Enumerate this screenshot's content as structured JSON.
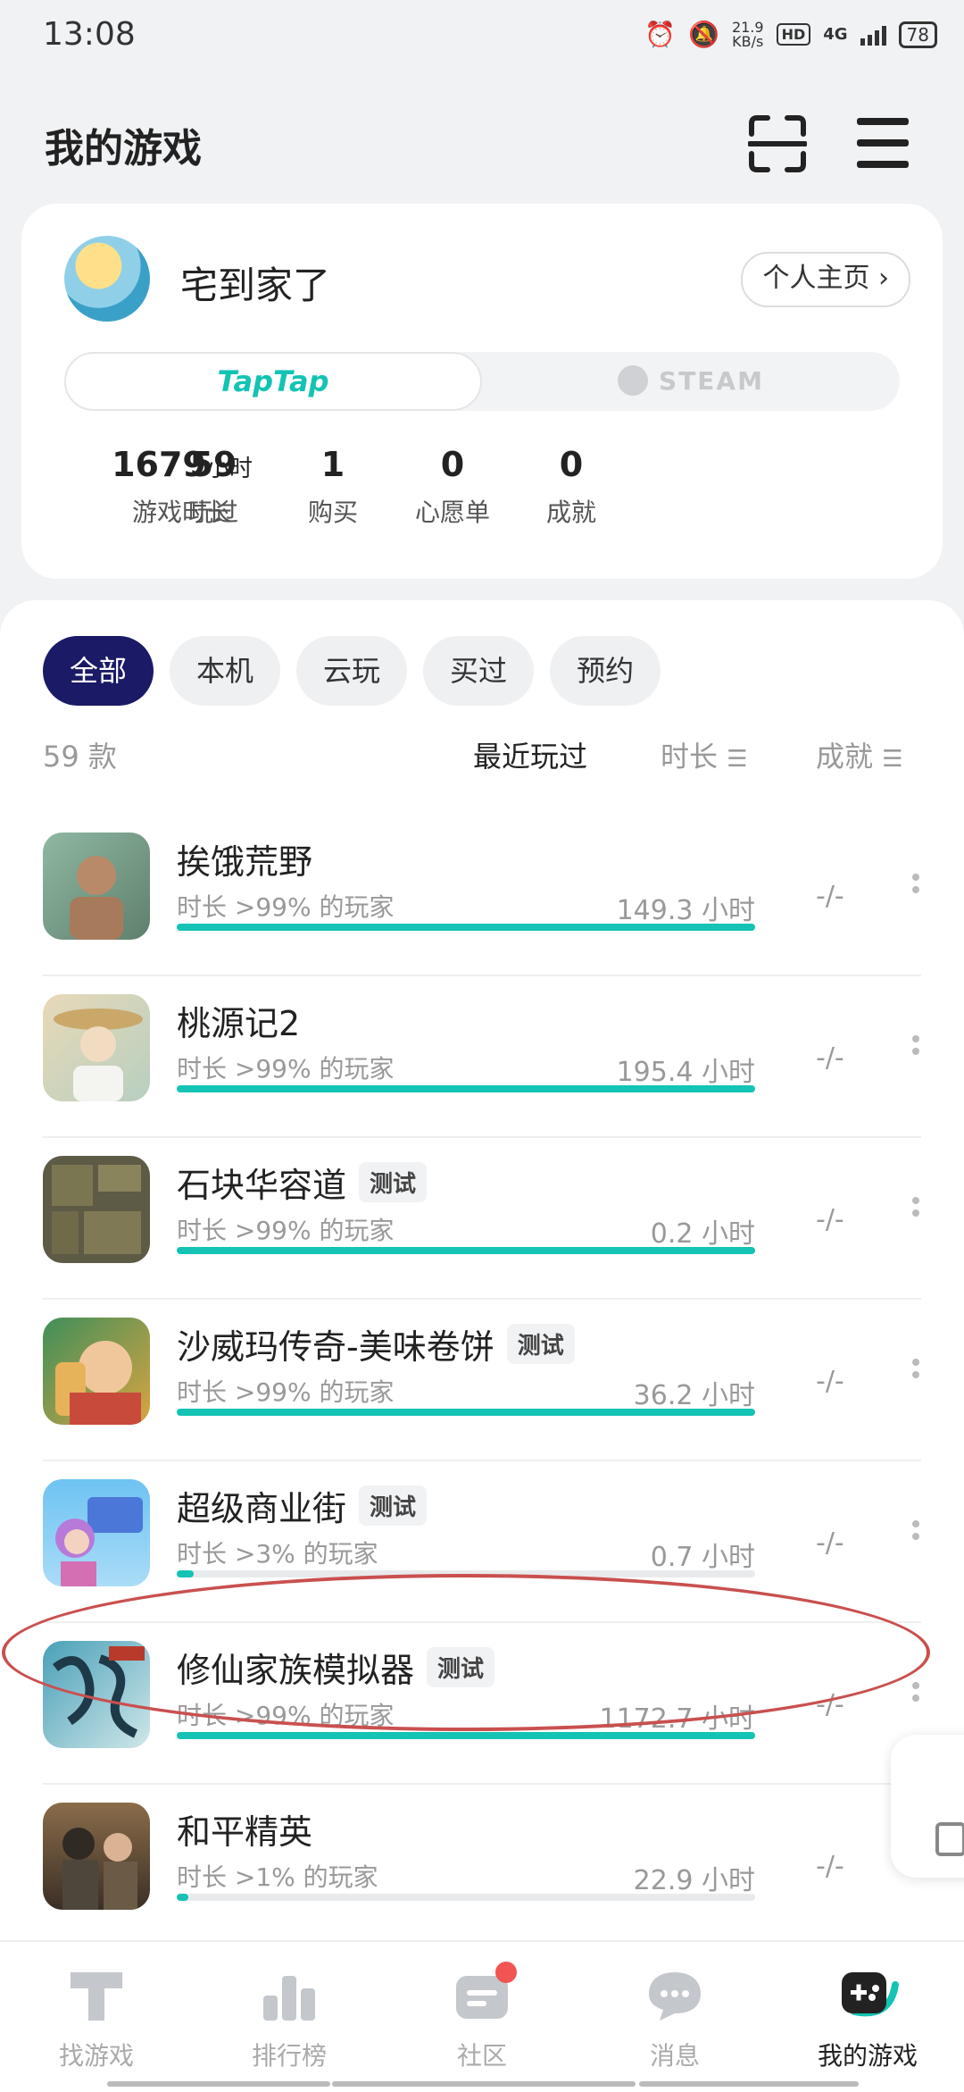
{
  "status_bar": {
    "time": "13:08",
    "speed_value": "21.9",
    "speed_unit": "KB/s",
    "hd": "HD",
    "network": "4G",
    "battery": "78"
  },
  "header": {
    "title": "我的游戏"
  },
  "profile": {
    "username": "宅到家了",
    "home_button": "个人主页 ›",
    "platform_tabs": {
      "taptap": "TapTap",
      "steam": "STEAM"
    },
    "stats": [
      {
        "value": "1679",
        "unit": "小时",
        "label": "游戏时长"
      },
      {
        "value": "59",
        "unit": "",
        "label": "玩过"
      },
      {
        "value": "1",
        "unit": "",
        "label": "购买"
      },
      {
        "value": "0",
        "unit": "",
        "label": "心愿单"
      },
      {
        "value": "0",
        "unit": "",
        "label": "成就"
      }
    ]
  },
  "filters": [
    "全部",
    "本机",
    "云玩",
    "买过",
    "预约"
  ],
  "sort": {
    "count": "59 款",
    "recent": "最近玩过",
    "duration": "时长",
    "achievement": "成就"
  },
  "games": [
    {
      "name": "挨饿荒野",
      "tag": "",
      "percentile": "时长 >99% 的玩家",
      "hours": "149.3 小时",
      "progress": 1.0,
      "achievement": "-/-"
    },
    {
      "name": "桃源记2",
      "tag": "",
      "percentile": "时长 >99% 的玩家",
      "hours": "195.4 小时",
      "progress": 1.0,
      "achievement": "-/-"
    },
    {
      "name": "石块华容道",
      "tag": "测试",
      "percentile": "时长 >99% 的玩家",
      "hours": "0.2 小时",
      "progress": 1.0,
      "achievement": "-/-"
    },
    {
      "name": "沙威玛传奇-美味卷饼",
      "tag": "测试",
      "percentile": "时长 >99% 的玩家",
      "hours": "36.2 小时",
      "progress": 1.0,
      "achievement": "-/-"
    },
    {
      "name": "超级商业街",
      "tag": "测试",
      "percentile": "时长 >3% 的玩家",
      "hours": "0.7 小时",
      "progress": 0.03,
      "achievement": "-/-"
    },
    {
      "name": "修仙家族模拟器",
      "tag": "测试",
      "percentile": "时长 >99% 的玩家",
      "hours": "1172.7 小时",
      "progress": 1.0,
      "achievement": "-/-"
    },
    {
      "name": "和平精英",
      "tag": "",
      "percentile": "时长 >1% 的玩家",
      "hours": "22.9 小时",
      "progress": 0.01,
      "achievement": "-/-"
    }
  ],
  "bottom_nav": [
    {
      "label": "找游戏",
      "icon": "find-games-icon",
      "active": false
    },
    {
      "label": "排行榜",
      "icon": "ranking-icon",
      "active": false
    },
    {
      "label": "社区",
      "icon": "community-icon",
      "active": false
    },
    {
      "label": "消息",
      "icon": "message-icon",
      "active": false
    },
    {
      "label": "我的游戏",
      "icon": "my-games-icon",
      "active": true
    }
  ],
  "colors": {
    "accent": "#14c3b4",
    "active_chip": "#1a1a66",
    "annotation": "#c9504f",
    "badge": "#f25353"
  }
}
